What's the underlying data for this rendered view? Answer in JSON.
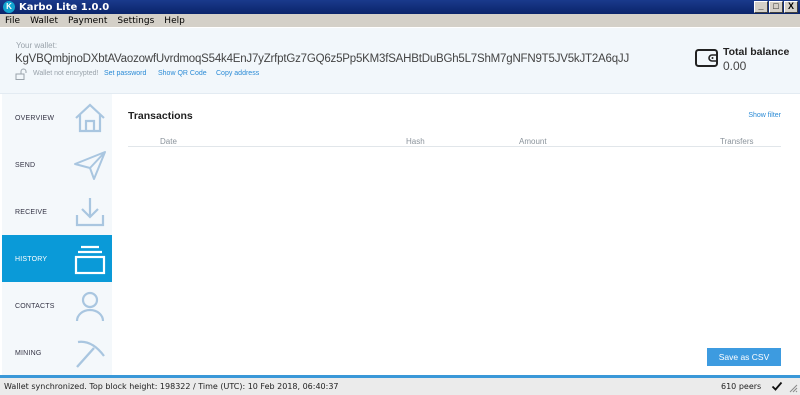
{
  "window": {
    "title": "Karbo Lite 1.0.0",
    "icon_letter": "K",
    "minimize": "_",
    "maximize": "□",
    "close": "X"
  },
  "menu": [
    "File",
    "Wallet",
    "Payment",
    "Settings",
    "Help"
  ],
  "header": {
    "wallet_label": "Your wallet:",
    "address": "KgVBQmbjnoDXbtAVaozowfUvrdmoqS54k4EnJ7yZrfptGz7GQ6z5Pp5KM3fSAHBtDuBGh5L7ShM7gNFN9T5JV5kJT2A6qJJ",
    "encryption_status": "Wallet not encrypted!",
    "set_password": "Set password",
    "show_qr": "Show QR Code",
    "copy_address": "Copy address",
    "balance_label": "Total balance",
    "balance_value": "0.00"
  },
  "sidebar": {
    "items": [
      {
        "label": "OVERVIEW",
        "icon": "home-icon"
      },
      {
        "label": "SEND",
        "icon": "send-icon"
      },
      {
        "label": "RECEIVE",
        "icon": "receive-icon"
      },
      {
        "label": "HISTORY",
        "icon": "history-icon",
        "active": true
      },
      {
        "label": "CONTACTS",
        "icon": "contacts-icon"
      },
      {
        "label": "MINING",
        "icon": "pickaxe-icon"
      }
    ]
  },
  "transactions": {
    "title": "Transactions",
    "show_filter": "Show filter",
    "columns": [
      "Date",
      "Hash",
      "Amount",
      "Transfers"
    ],
    "rows": [],
    "save_csv": "Save as CSV"
  },
  "status": {
    "text": "Wallet synchronized. Top block height: 198322  /  Time (UTC): 10 Feb 2018, 06:40:37",
    "peers": "610 peers"
  },
  "colors": {
    "accent": "#0a9ad8",
    "link": "#2b8bd6",
    "icon": "#a9c6e0"
  }
}
